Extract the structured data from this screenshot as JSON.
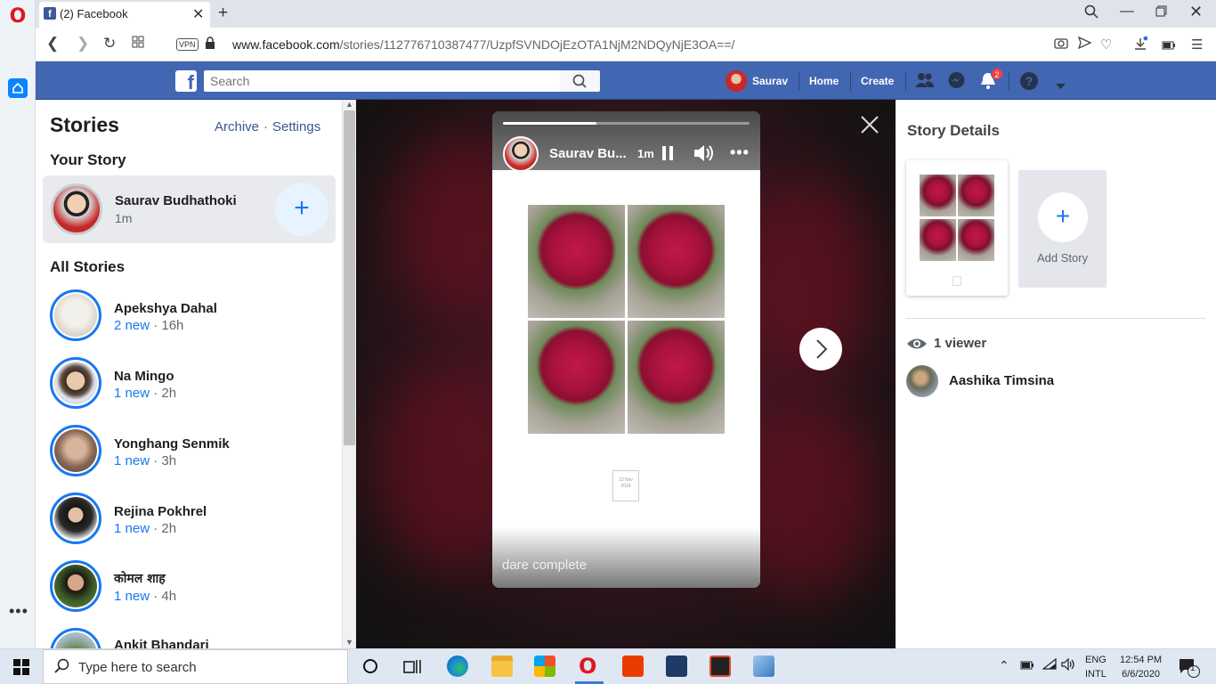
{
  "browser": {
    "tab_title": "(2) Facebook",
    "tab_favicon": "f",
    "new_tab": "+",
    "vpn_label": "VPN",
    "url_host": "www.facebook.com",
    "url_path": "/stories/112776710387477/UzpfSVNDOjEzOTA1NjM2NDQyNjE3OA==/"
  },
  "fb_header": {
    "logo": "f",
    "search_placeholder": "Search",
    "user_name": "Saurav",
    "home_label": "Home",
    "create_label": "Create",
    "notification_count": "2",
    "brand_color": "#4267b2"
  },
  "stories_panel": {
    "title": "Stories",
    "archive_label": "Archive",
    "separator": "·",
    "settings_label": "Settings",
    "your_story_heading": "Your Story",
    "your_story": {
      "name": "Saurav Budhathoki",
      "time": "1m"
    },
    "add_button": "+",
    "all_stories_heading": "All Stories",
    "all_stories": [
      {
        "name": "Apekshya Dahal",
        "new": "2 new",
        "time": "16h"
      },
      {
        "name": "Na Mingo",
        "new": "1 new",
        "time": "2h"
      },
      {
        "name": "Yonghang Senmik",
        "new": "1 new",
        "time": "3h"
      },
      {
        "name": "Rejina Pokhrel",
        "new": "1 new",
        "time": "2h"
      },
      {
        "name": "कोमल शाह",
        "new": "1 new",
        "time": "4h"
      },
      {
        "name": "Ankit Bhandari",
        "new": "",
        "time": ""
      }
    ],
    "meta_separator": " · "
  },
  "story_viewer": {
    "owner_name": "Saurav Bu...",
    "owner_time": "1m",
    "progress": 0.38,
    "date_stamp_line1": "13 Nov",
    "date_stamp_line2": "2019",
    "caption": "dare complete",
    "accent_color": "#c01848"
  },
  "story_details": {
    "title": "Story Details",
    "add_story_label": "Add Story",
    "add_icon": "+",
    "viewer_count": "1 viewer",
    "viewers": [
      {
        "name": "Aashika Timsina"
      }
    ]
  },
  "taskbar": {
    "search_placeholder": "Type here to search",
    "lang_line1": "ENG",
    "lang_line2": "INTL",
    "time": "12:54 PM",
    "date": "6/6/2020",
    "notification_count": "1"
  }
}
